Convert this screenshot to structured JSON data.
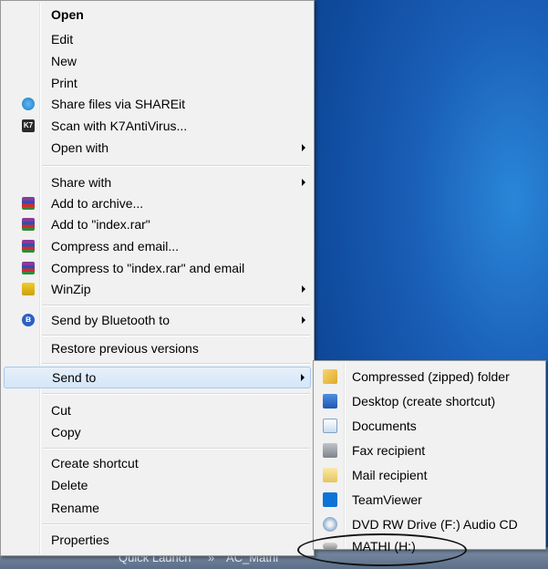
{
  "context_menu": {
    "items": [
      {
        "label": "Open",
        "icon": "",
        "bold": true
      },
      {
        "label": "Edit",
        "icon": ""
      },
      {
        "label": "New",
        "icon": ""
      },
      {
        "label": "Print",
        "icon": ""
      },
      {
        "label": "Share files via SHAREit",
        "icon": "shareit-icon"
      },
      {
        "label": "Scan with K7AntiVirus...",
        "icon": "k7-antivirus-icon"
      },
      {
        "label": "Open with",
        "icon": "",
        "submenu": true
      },
      {
        "label": "Share with",
        "icon": "",
        "submenu": true
      },
      {
        "label": "Add to archive...",
        "icon": "winrar-icon"
      },
      {
        "label": "Add to \"index.rar\"",
        "icon": "winrar-icon"
      },
      {
        "label": "Compress and email...",
        "icon": "winrar-icon"
      },
      {
        "label": "Compress to \"index.rar\" and email",
        "icon": "winrar-icon"
      },
      {
        "label": "WinZip",
        "icon": "winzip-icon",
        "submenu": true
      },
      {
        "label": "Send by Bluetooth to",
        "icon": "bluetooth-icon",
        "submenu": true
      },
      {
        "label": "Restore previous versions",
        "icon": ""
      },
      {
        "label": "Send to",
        "icon": "",
        "submenu": true,
        "highlighted": true
      },
      {
        "label": "Cut",
        "icon": ""
      },
      {
        "label": "Copy",
        "icon": ""
      },
      {
        "label": "Create shortcut",
        "icon": ""
      },
      {
        "label": "Delete",
        "icon": ""
      },
      {
        "label": "Rename",
        "icon": ""
      },
      {
        "label": "Properties",
        "icon": ""
      }
    ],
    "icon_glyphs": {
      "k7": "K7",
      "bluetooth": "ʙ"
    }
  },
  "send_to_submenu": {
    "items": [
      {
        "label": "Compressed (zipped) folder",
        "icon": "zipped-folder-icon"
      },
      {
        "label": "Desktop (create shortcut)",
        "icon": "desktop-icon"
      },
      {
        "label": "Documents",
        "icon": "documents-icon"
      },
      {
        "label": "Fax recipient",
        "icon": "fax-icon"
      },
      {
        "label": "Mail recipient",
        "icon": "mail-icon"
      },
      {
        "label": "TeamViewer",
        "icon": "teamviewer-icon"
      },
      {
        "label": "DVD RW Drive (F:) Audio CD",
        "icon": "dvd-drive-icon"
      },
      {
        "label": "MATHI (H:)",
        "icon": "usb-drive-icon",
        "circled": true
      }
    ]
  },
  "taskbar": {
    "quick_launch": "Quick Launch",
    "chevron": "»",
    "user": "AC_Mathi"
  },
  "colors": {
    "menu_bg": "#f1f1f1",
    "highlight": "#d4e6f8",
    "desktop": "#1a5fb8"
  }
}
